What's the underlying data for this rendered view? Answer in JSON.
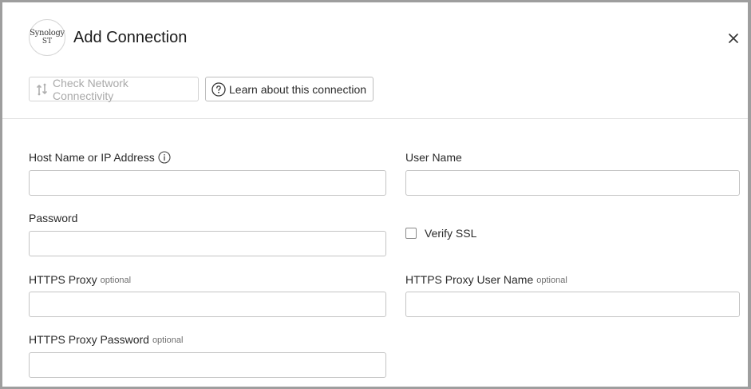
{
  "dialog": {
    "logo": {
      "line1": "Synology",
      "line2": "ST"
    },
    "title": "Add Connection",
    "close_icon": "close-icon"
  },
  "toolbar": {
    "check_network": {
      "label": "Check Network Connectivity",
      "icon": "network-check-icon",
      "disabled": true
    },
    "learn": {
      "label": "Learn about this connection",
      "icon": "help-circle-icon"
    }
  },
  "form": {
    "host": {
      "label": "Host Name or IP Address",
      "value": "",
      "info_icon": "info-icon"
    },
    "user_name": {
      "label": "User Name",
      "value": ""
    },
    "password": {
      "label": "Password",
      "value": ""
    },
    "verify_ssl": {
      "label": "Verify SSL",
      "checked": false
    },
    "https_proxy": {
      "label": "HTTPS Proxy",
      "optional": "optional",
      "value": ""
    },
    "https_proxy_user": {
      "label": "HTTPS Proxy User Name",
      "optional": "optional",
      "value": ""
    },
    "https_proxy_password": {
      "label": "HTTPS Proxy Password",
      "optional": "optional",
      "value": ""
    }
  },
  "colors": {
    "disabled_text": "#a9a9a9",
    "border": "#c4c4c4",
    "divider": "#e2e2e2",
    "overlay": "#9e9e9e"
  }
}
